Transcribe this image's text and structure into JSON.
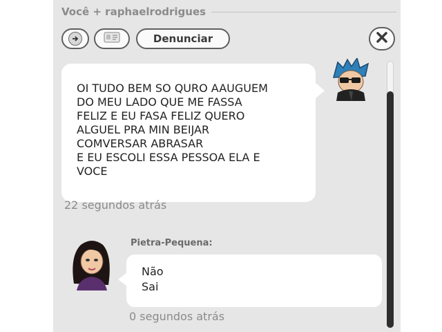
{
  "window": {
    "title": "Você + raphaelrodrigues"
  },
  "toolbar": {
    "report_label": "Denunciar",
    "icons": {
      "back": "arrow-right-icon",
      "profile": "id-card-icon",
      "close": "close-x-icon"
    }
  },
  "messages": [
    {
      "text": "OI TUDO BEM SO QURO AAUGUEM\nDO MEU LADO QUE ME FASSA\nFELIZ E EU FASA FELIZ QUERO\nALGUEL PRA MIN BEIJAR\nCOMVERSAR ABRASAR\nE EU ESCOLI ESSA PESSOA ELA E\nVOCE",
      "time": "22 segundos atrás"
    },
    {
      "sender": "Pietra-Pequena:",
      "lines": [
        "Não",
        "Sai"
      ],
      "time": "0 segundos atrás"
    }
  ],
  "colors": {
    "panel": "#e6e6e6",
    "bubble": "#ffffff",
    "scrollbar": "#2e2e2e"
  }
}
